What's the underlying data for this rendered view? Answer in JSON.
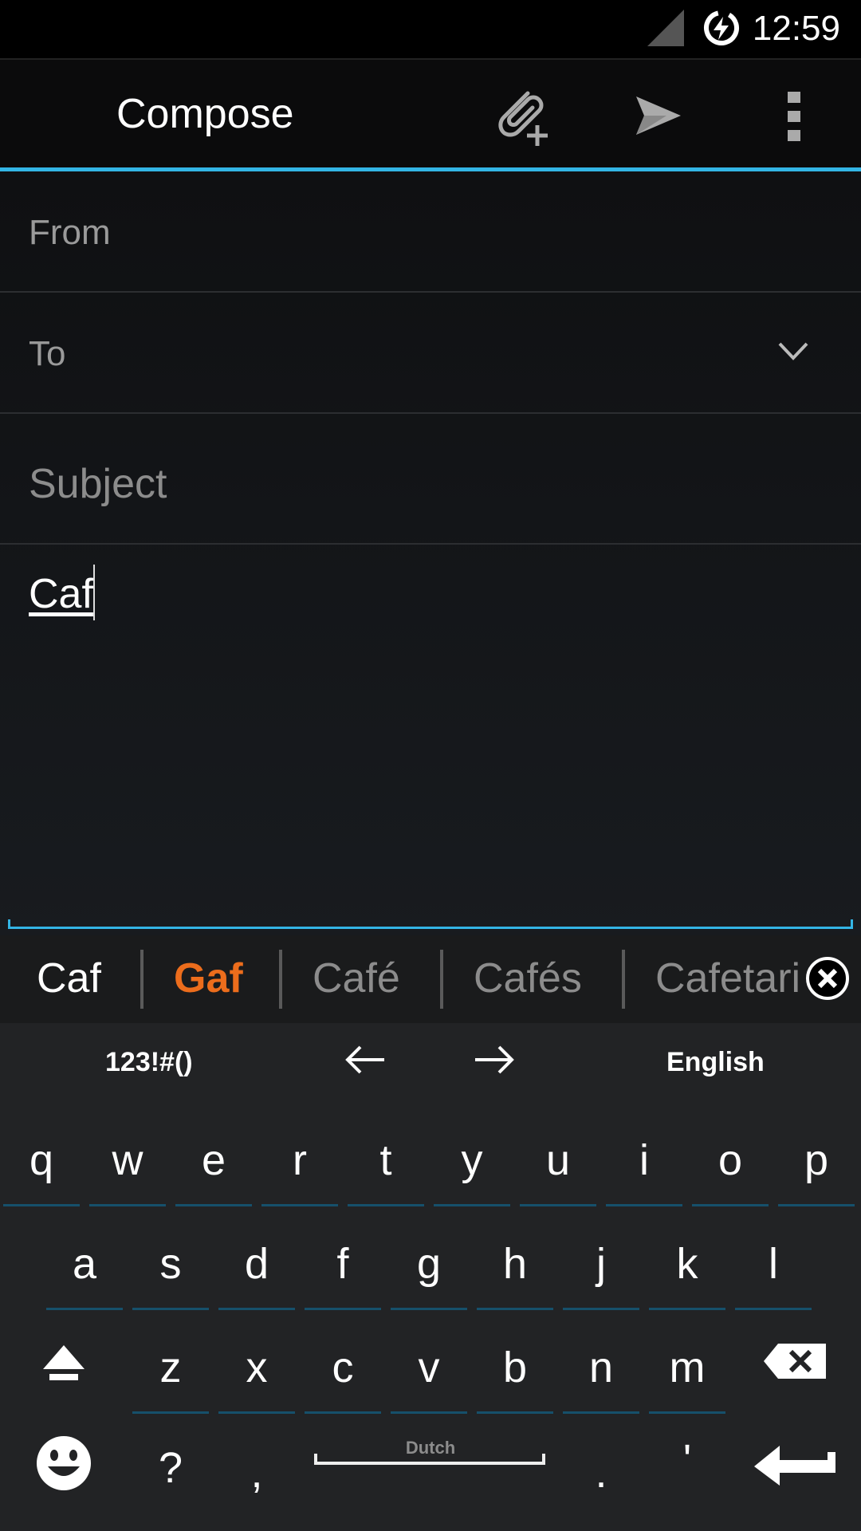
{
  "status_bar": {
    "time": "12:59",
    "icons": [
      "signal-icon",
      "battery-charging-icon"
    ]
  },
  "action_bar": {
    "title": "Compose",
    "actions": [
      "attach-icon",
      "send-icon",
      "overflow-menu-icon"
    ]
  },
  "compose": {
    "from_label": "From",
    "to_label": "To",
    "subject_placeholder": "Subject",
    "body_text": "Caf"
  },
  "keyboard": {
    "suggestions": [
      "Caf",
      "Gaf",
      "Café",
      "Cafés",
      "Cafetari"
    ],
    "highlighted_suggestion": "Gaf",
    "toolbar": {
      "symbols_label": "123!#()",
      "language_label": "English"
    },
    "rows": [
      [
        "q",
        "w",
        "e",
        "r",
        "t",
        "y",
        "u",
        "i",
        "o",
        "p"
      ],
      [
        "a",
        "s",
        "d",
        "f",
        "g",
        "h",
        "j",
        "k",
        "l"
      ],
      [
        "z",
        "x",
        "c",
        "v",
        "b",
        "n",
        "m"
      ]
    ],
    "bottom_row": {
      "question": "?",
      "comma": ",",
      "space_label": "Dutch",
      "period": ".",
      "apostrophe": "'"
    }
  },
  "colors": {
    "accent": "#33b5e5",
    "suggestion_highlight": "#ec6d1c"
  }
}
